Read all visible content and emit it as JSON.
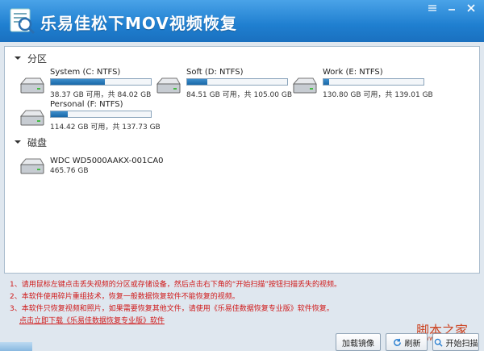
{
  "window": {
    "title": "乐易佳松下MOV视频恢复"
  },
  "partitions": {
    "header": "分区",
    "items": [
      {
        "name": "System (C: NTFS)",
        "info": "38.37 GB 可用，共 84.02 GB",
        "used_fraction": 0.54
      },
      {
        "name": "Soft (D: NTFS)",
        "info": "84.51 GB 可用，共 105.00 GB",
        "used_fraction": 0.2
      },
      {
        "name": "Work (E: NTFS)",
        "info": "130.80 GB 可用，共 139.01 GB",
        "used_fraction": 0.06
      },
      {
        "name": "Personal (F: NTFS)",
        "info": "114.42 GB 可用，共 137.73 GB",
        "used_fraction": 0.17
      }
    ]
  },
  "disks": {
    "header": "磁盘",
    "items": [
      {
        "name": "WDC WD5000AAKX-001CA0",
        "size": "465.76 GB"
      }
    ]
  },
  "notes": {
    "line1": "1、请用鼠标左键点击丢失视频的分区或存储设备，然后点击右下角的“开始扫描”按钮扫描丢失的视频。",
    "line2": "2、本软件使用碎片重组技术，恢复一般数据恢复软件不能恢复的视频。",
    "line3": "3、本软件只恢复视频和照片，如果需要恢复其他文件，请使用《乐易佳数据恢复专业版》软件恢复。",
    "link": "点击立即下载《乐易佳数据恢复专业版》软件"
  },
  "buttons": {
    "load_image": "加载镜像",
    "refresh": "刷新",
    "start_scan": "开始扫描"
  },
  "watermark": {
    "text": "脚本之家",
    "url": "www.jb51.net"
  },
  "colors": {
    "titlebar": "#1f7fd0",
    "note_text": "#d01a1a",
    "bar_fill": "#1767a8"
  }
}
